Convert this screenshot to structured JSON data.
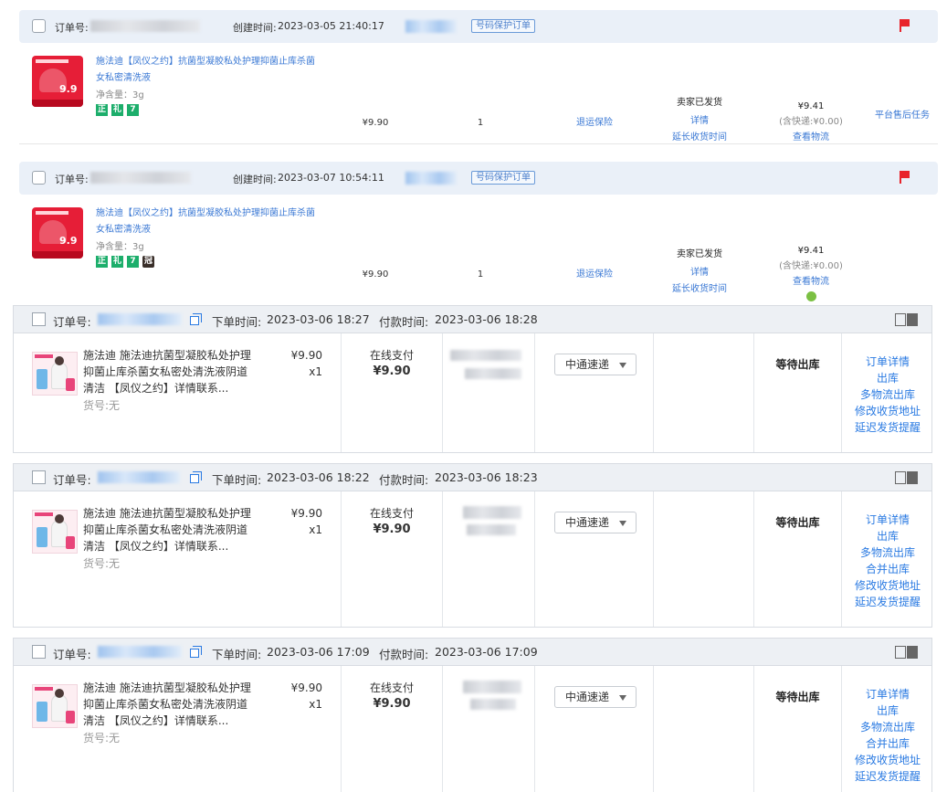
{
  "top_orders": [
    {
      "order_no_label": "订单号:",
      "created_label": "创建时间:",
      "created_time": "2023-03-05 21:40:17",
      "protect_tag": "号码保护订单",
      "title": "施法迪【凤仪之约】抗菌型凝胶私处护理抑菌止库杀菌女私密清洗液",
      "spec": "净含量：3g",
      "thumb_price": "9.9",
      "badges": [
        "正",
        "礼",
        "7"
      ],
      "price": "¥9.90",
      "qty": "1",
      "insurance": "退运保险",
      "status": "卖家已发货",
      "detail": "详情",
      "extend": "延长收货时间",
      "total": "¥9.41",
      "shipping": "(含快递:¥0.00)",
      "logistics": "查看物流",
      "after_sale": "平台售后任务"
    },
    {
      "order_no_label": "订单号:",
      "created_label": "创建时间:",
      "created_time": "2023-03-07 10:54:11",
      "protect_tag": "号码保护订单",
      "title": "施法迪【凤仪之约】抗菌型凝胶私处护理抑菌止库杀菌女私密清洗液",
      "spec": "净含量：3g",
      "thumb_price": "9.9",
      "badges": [
        "正",
        "礼",
        "7",
        "冠"
      ],
      "price": "¥9.90",
      "qty": "1",
      "insurance": "退运保险",
      "status": "卖家已发货",
      "detail": "详情",
      "extend": "延长收货时间",
      "total": "¥9.41",
      "shipping": "(含快递:¥0.00)",
      "logistics": "查看物流",
      "after_sale": ""
    }
  ],
  "erp_orders": [
    {
      "order_no_label": "订单号:",
      "order_time_label": "下单时间:",
      "order_time": "2023-03-06 18:27",
      "pay_time_label": "付款时间:",
      "pay_time": "2023-03-06 18:28",
      "title": "施法迪 施法迪抗菌型凝胶私处护理抑菌止库杀菌女私密处清洗液阴道清洁 【凤仪之约】详情联系...",
      "sku": "货号:无",
      "unit_price": "¥9.90",
      "qty": "x1",
      "pay_method": "在线支付",
      "pay_amount": "¥9.90",
      "courier": "中通速递",
      "status": "等待出库",
      "actions": [
        "订单详情",
        "出库",
        "多物流出库",
        "修改收货地址",
        "延迟发货提醒"
      ]
    },
    {
      "order_no_label": "订单号:",
      "order_time_label": "下单时间:",
      "order_time": "2023-03-06 18:22",
      "pay_time_label": "付款时间:",
      "pay_time": "2023-03-06 18:23",
      "title": "施法迪 施法迪抗菌型凝胶私处护理抑菌止库杀菌女私密处清洗液阴道清洁 【凤仪之约】详情联系...",
      "sku": "货号:无",
      "unit_price": "¥9.90",
      "qty": "x1",
      "pay_method": "在线支付",
      "pay_amount": "¥9.90",
      "courier": "中通速递",
      "status": "等待出库",
      "actions": [
        "订单详情",
        "出库",
        "多物流出库",
        "合并出库",
        "修改收货地址",
        "延迟发货提醒"
      ]
    },
    {
      "order_no_label": "订单号:",
      "order_time_label": "下单时间:",
      "order_time": "2023-03-06 17:09",
      "pay_time_label": "付款时间:",
      "pay_time": "2023-03-06 17:09",
      "title": "施法迪 施法迪抗菌型凝胶私处护理抑菌止库杀菌女私密处清洗液阴道清洁 【凤仪之约】详情联系...",
      "sku": "货号:无",
      "unit_price": "¥9.90",
      "qty": "x1",
      "pay_method": "在线支付",
      "pay_amount": "¥9.90",
      "courier": "中通速递",
      "status": "等待出库",
      "actions": [
        "订单详情",
        "出库",
        "多物流出库",
        "合并出库",
        "修改收货地址",
        "延迟发货提醒"
      ]
    }
  ],
  "colors": {
    "link": "#2a7ae2",
    "flag": "#e8232b",
    "header_bg": "#eaf0f8"
  }
}
